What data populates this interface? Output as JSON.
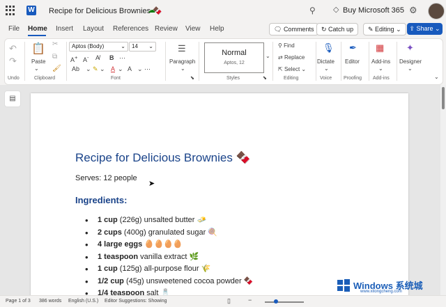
{
  "titlebar": {
    "doc_title": "Recipe for Delicious Brownies 🍫",
    "buy_label": "Buy Microsoft 365"
  },
  "menu": {
    "tabs": [
      "File",
      "Home",
      "Insert",
      "Layout",
      "References",
      "Review",
      "View",
      "Help"
    ],
    "comments_label": "Comments",
    "catchup_label": "Catch up",
    "editing_label": "Editing",
    "share_label": "Share"
  },
  "ribbon": {
    "undo": "Undo",
    "paste": "Paste",
    "clipboard": "Clipboard",
    "font_name": "Aptos (Body)",
    "font_size": "14",
    "font_group": "Font",
    "paragraph": "Paragraph",
    "style_name": "Normal",
    "style_sub": "Aptos, 12",
    "styles_group": "Styles",
    "find": "Find",
    "replace": "Replace",
    "select": "Select",
    "editing_group": "Editing",
    "dictate": "Dictate",
    "voice_group": "Voice",
    "editor": "Editor",
    "proofing_group": "Proofing",
    "addins": "Add-ins",
    "addins_group": "Add-ins",
    "designer": "Designer"
  },
  "document": {
    "title": "Recipe for Delicious Brownies 🍫",
    "serves": "Serves: 12 people",
    "ingredients_heading": "Ingredients:",
    "ingredients": [
      {
        "bold": "1 cup",
        "rest": " (226g) unsalted butter 🧈"
      },
      {
        "bold": "2 cups",
        "rest": " (400g) granulated sugar 🍭"
      },
      {
        "bold": "4 large eggs",
        "rest": " 🥚🥚🥚🥚"
      },
      {
        "bold": "1 teaspoon",
        "rest": " vanilla extract 🌿"
      },
      {
        "bold": "1 cup",
        "rest": " (125g) all-purpose flour 🌾"
      },
      {
        "bold": "1/2 cup",
        "rest": " (45g) unsweetened cocoa powder 🍫"
      },
      {
        "bold": "1/4 teaspoon",
        "rest": " salt 🧂"
      }
    ]
  },
  "status": {
    "page": "Page 1 of 3",
    "words": "386 words",
    "language": "English (U.S.)",
    "suggestions": "Editor Suggestions: Showing"
  },
  "watermark": {
    "brand": "Windows",
    "brand_cn": "系统城",
    "url": "www.xitongcheng.com"
  }
}
